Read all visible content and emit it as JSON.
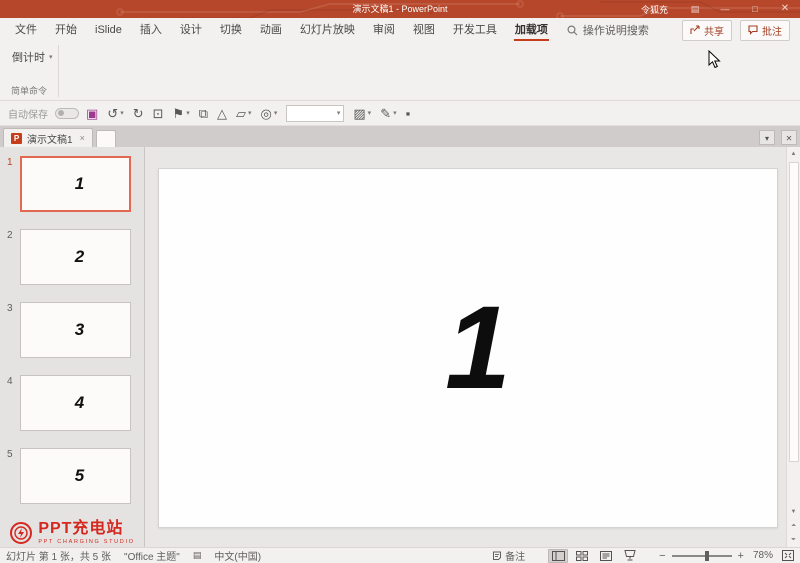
{
  "title_bar": {
    "title": "演示文稿1 - PowerPoint",
    "user": "令狐充"
  },
  "menu": {
    "tabs": [
      "文件",
      "开始",
      "iSlide",
      "插入",
      "设计",
      "切换",
      "动画",
      "幻灯片放映",
      "审阅",
      "视图",
      "开发工具",
      "加载项"
    ],
    "active_tab": "加载项",
    "search_label": "操作说明搜索",
    "share_label": "共享",
    "comments_label": "批注"
  },
  "ribbon": {
    "countdown_label": "倒计时",
    "group_label": "简单命令"
  },
  "quick_access": {
    "autosave_label": "自动保存",
    "items": [
      {
        "name": "save-icon",
        "glyph": "▣",
        "color": "#9c3a90"
      },
      {
        "name": "undo-icon",
        "glyph": "↺",
        "dropdown": true
      },
      {
        "name": "redo-icon",
        "glyph": "↻"
      },
      {
        "name": "slideshow-from-beginning-icon",
        "glyph": "⊡"
      },
      {
        "name": "flag-icon",
        "glyph": "⚑",
        "dropdown": true
      },
      {
        "name": "crop-icon",
        "glyph": "⧉"
      },
      {
        "name": "shape-fill-icon",
        "glyph": "△"
      },
      {
        "name": "shapes-icon",
        "glyph": "▱",
        "dropdown": true
      },
      {
        "name": "rotate-object-icon",
        "glyph": "◎",
        "dropdown": true
      },
      {
        "name": "font-combo",
        "type": "combo"
      },
      {
        "name": "shape-effects-icon",
        "glyph": "▨",
        "dropdown": true
      },
      {
        "name": "ink-pen-icon",
        "glyph": "✎",
        "dropdown": true
      },
      {
        "name": "qat-overflow-icon",
        "glyph": "▪"
      }
    ]
  },
  "doc_tabs": {
    "active_title": "演示文稿1"
  },
  "slides_panel": {
    "slides": [
      {
        "num": "1",
        "content": "1",
        "selected": true
      },
      {
        "num": "2",
        "content": "2",
        "selected": false
      },
      {
        "num": "3",
        "content": "3",
        "selected": false
      },
      {
        "num": "4",
        "content": "4",
        "selected": false
      },
      {
        "num": "5",
        "content": "5",
        "selected": false
      }
    ]
  },
  "canvas": {
    "slide_text": "1"
  },
  "branding": {
    "logo_text": "PPT充电站",
    "logo_subtext": "PPT CHARGING STUDIO"
  },
  "status_bar": {
    "slide_info": "幻灯片 第 1 张，共 5 张",
    "theme": "\"Office 主题\"",
    "language": "中文(中国)",
    "notes_label": "备注",
    "zoom_level": "78%"
  },
  "colors": {
    "titlebar": "#B7472A",
    "accent": "#C43E1C",
    "selection": "#E0694F",
    "logo_red": "#D5281F"
  }
}
